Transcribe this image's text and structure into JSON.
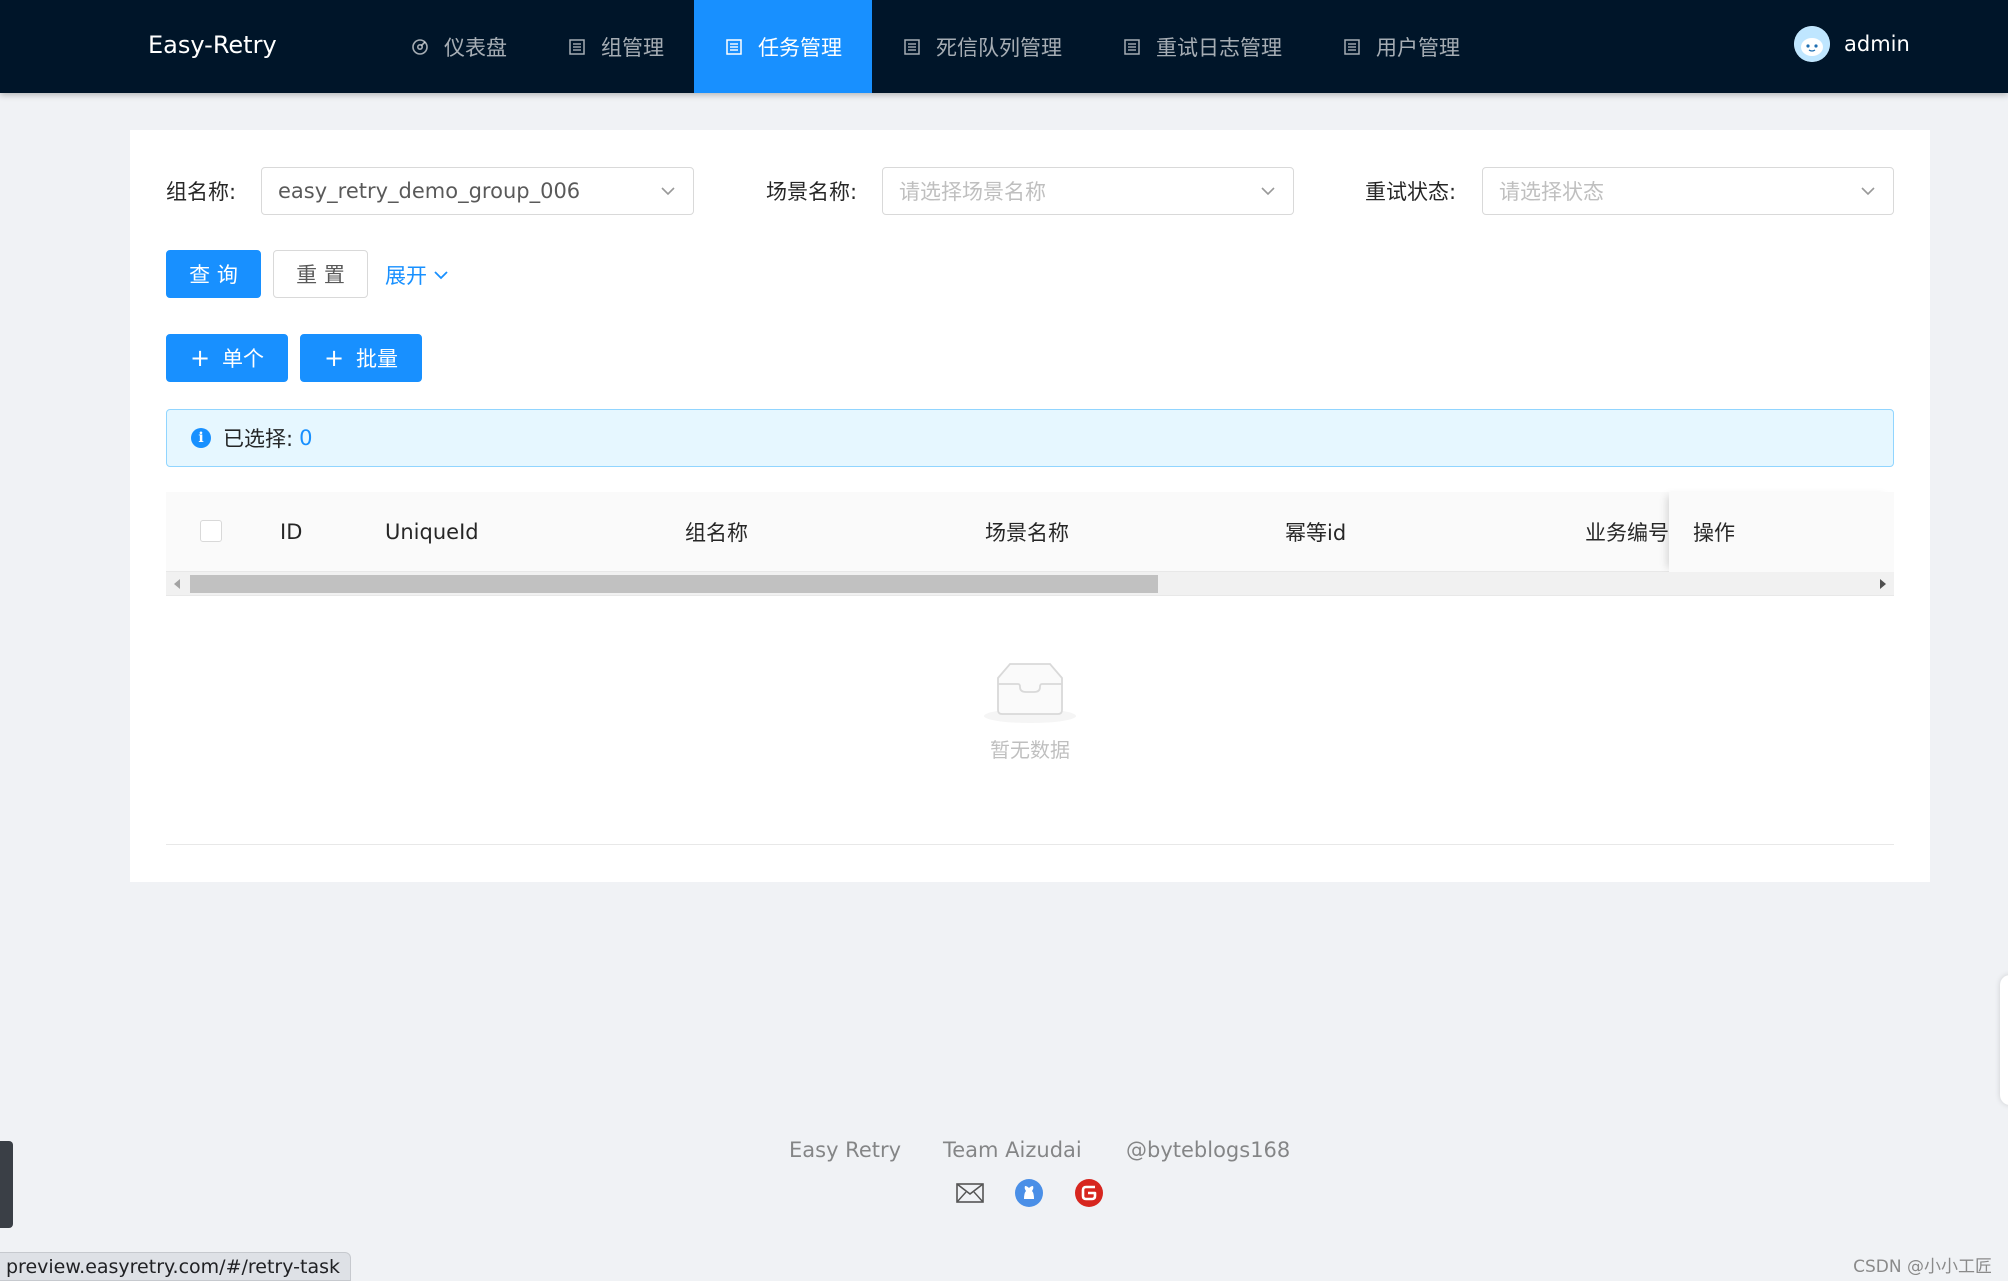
{
  "header": {
    "logo": "Easy-Retry",
    "nav": [
      {
        "label": "仪表盘",
        "icon": "dashboard-icon"
      },
      {
        "label": "组管理",
        "icon": "list-icon"
      },
      {
        "label": "任务管理",
        "icon": "list-icon",
        "active": true
      },
      {
        "label": "死信队列管理",
        "icon": "list-icon"
      },
      {
        "label": "重试日志管理",
        "icon": "list-icon"
      },
      {
        "label": "用户管理",
        "icon": "list-icon"
      }
    ],
    "user": "admin"
  },
  "filters": {
    "group_label": "组名称:",
    "group_value": "easy_retry_demo_group_006",
    "scene_label": "场景名称:",
    "scene_placeholder": "请选择场景名称",
    "status_label": "重试状态:",
    "status_placeholder": "请选择状态"
  },
  "actions": {
    "query": "查 询",
    "reset": "重 置",
    "expand": "展开",
    "add_single": "单个",
    "add_batch": "批量"
  },
  "alert": {
    "label": "已选择:",
    "count": "0"
  },
  "table": {
    "columns": [
      "ID",
      "UniqueId",
      "组名称",
      "场景名称",
      "幂等id",
      "业务编号",
      "操作"
    ],
    "empty_text": "暂无数据"
  },
  "footer": {
    "links": [
      "Easy Retry",
      "Team Aizudai",
      "@byteblogs168"
    ],
    "icons": [
      "mail-icon",
      "github-icon",
      "gitee-icon"
    ]
  },
  "statusbar": {
    "url": "preview.easyretry.com/#/retry-task"
  },
  "watermark": "CSDN @小小工匠",
  "colors": {
    "header_bg": "#001529",
    "primary": "#1890ff",
    "alert_bg": "#e6f7ff"
  }
}
